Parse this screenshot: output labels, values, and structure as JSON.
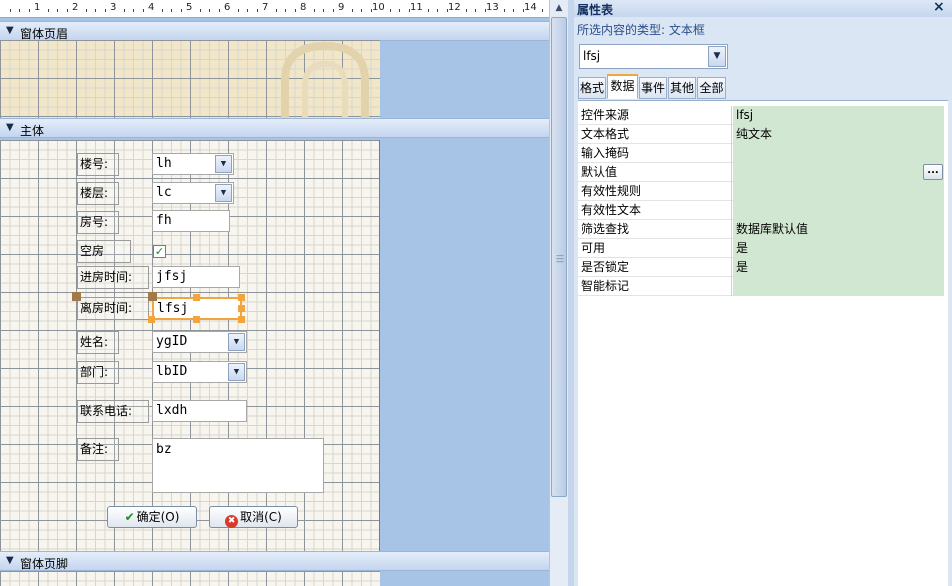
{
  "designer": {
    "ruler_numbers": [
      "1",
      "2",
      "3",
      "4",
      "5",
      "6",
      "7",
      "8",
      "9",
      "10",
      "11",
      "12",
      "13",
      "14"
    ],
    "sections": {
      "header": "窗体页眉",
      "detail": "主体",
      "footer": "窗体页脚"
    },
    "labels": {
      "building": "楼号:",
      "floor": "楼层:",
      "room": "房号:",
      "vacant": "空房",
      "checkin": "进房时间:",
      "checkout": "离房时间:",
      "name": "姓名:",
      "dept": "部门:",
      "phone": "联系电话:",
      "note": "备注:"
    },
    "fields": {
      "building": "lh",
      "floor": "lc",
      "room": "fh",
      "vacant_check": "✓",
      "checkin": "jfsj",
      "checkout": "lfsj",
      "name": "ygID",
      "dept": "lbID",
      "phone": "lxdh",
      "note": "bz"
    },
    "buttons": {
      "ok": "确定(O)",
      "cancel": "取消(C)"
    }
  },
  "property_sheet": {
    "title": "属性表",
    "close": "×",
    "selection_type": "所选内容的类型: 文本框",
    "selected_object": "lfsj",
    "tabs": [
      "格式",
      "数据",
      "事件",
      "其他",
      "全部"
    ],
    "active_tab": "数据",
    "rows": [
      {
        "name": "控件来源",
        "value": "lfsj"
      },
      {
        "name": "文本格式",
        "value": "纯文本"
      },
      {
        "name": "输入掩码",
        "value": ""
      },
      {
        "name": "默认值",
        "value": ""
      },
      {
        "name": "有效性规则",
        "value": ""
      },
      {
        "name": "有效性文本",
        "value": ""
      },
      {
        "name": "筛选查找",
        "value": "数据库默认值"
      },
      {
        "name": "可用",
        "value": "是"
      },
      {
        "name": "是否锁定",
        "value": "是"
      },
      {
        "name": "智能标记",
        "value": ""
      }
    ],
    "builder_button": "..."
  },
  "colors": {
    "selection": "#f2a53c",
    "designer_bg": "#a7c3e6",
    "value_cell": "#d2e7d2"
  }
}
